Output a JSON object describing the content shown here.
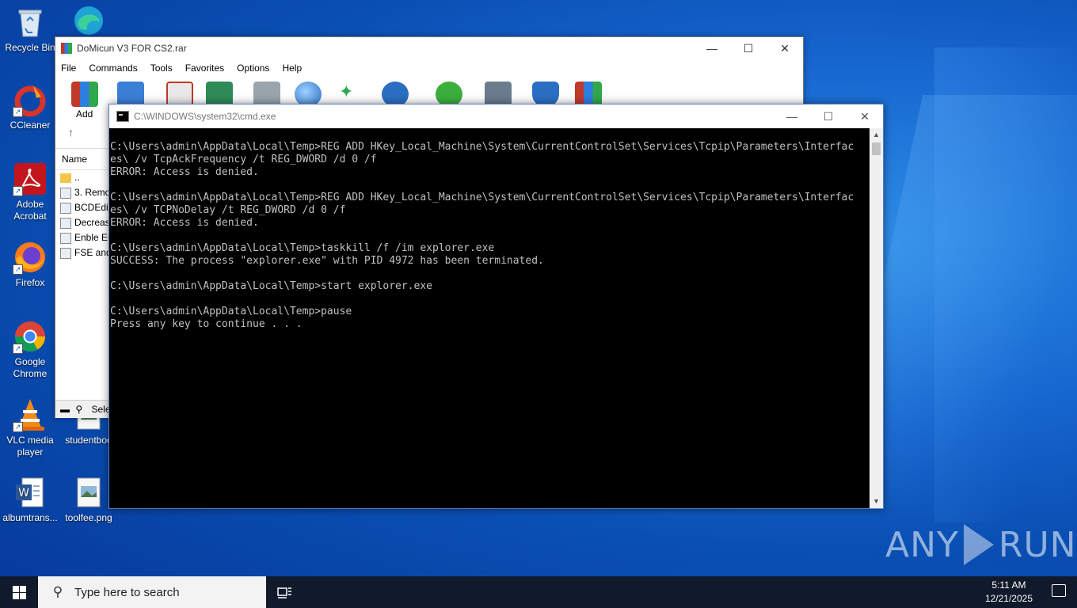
{
  "desktop": {
    "icons": [
      {
        "label": "Recycle Bin",
        "icon": "recycle-bin-icon"
      },
      {
        "label": "CCleaner",
        "icon": "ccleaner-icon"
      },
      {
        "label": "Adobe Acrobat",
        "icon": "adobe-acrobat-icon"
      },
      {
        "label": "Firefox",
        "icon": "firefox-icon"
      },
      {
        "label": "Google Chrome",
        "icon": "chrome-icon"
      },
      {
        "label": "VLC media player",
        "icon": "vlc-icon"
      },
      {
        "label": "albumtrans...",
        "icon": "word-doc-icon"
      },
      {
        "label": "studentboo",
        "icon": "image-file-icon"
      },
      {
        "label": "toolfee.png",
        "icon": "image-file-icon"
      }
    ]
  },
  "winrar": {
    "title": "DoMicun V3 FOR CS2.rar",
    "menu": [
      "File",
      "Commands",
      "Tools",
      "Favorites",
      "Options",
      "Help"
    ],
    "toolbar_add_label": "Add",
    "list_header": "Name",
    "files": [
      "..",
      "3. Remo",
      "BCDEdit",
      "Decrease",
      "Enble EC",
      "FSE and"
    ],
    "status_text": "Sele"
  },
  "cmd": {
    "title": "C:\\WINDOWS\\system32\\cmd.exe",
    "lines": [
      "C:\\Users\\admin\\AppData\\Local\\Temp>REG ADD HKey_Local_Machine\\System\\CurrentControlSet\\Services\\Tcpip\\Parameters\\Interfac",
      "es\\ /v TcpAckFrequency /t REG_DWORD /d 0 /f",
      "ERROR: Access is denied.",
      "",
      "C:\\Users\\admin\\AppData\\Local\\Temp>REG ADD HKey_Local_Machine\\System\\CurrentControlSet\\Services\\Tcpip\\Parameters\\Interfac",
      "es\\ /v TCPNoDelay /t REG_DWORD /d 0 /f",
      "ERROR: Access is denied.",
      "",
      "C:\\Users\\admin\\AppData\\Local\\Temp>taskkill /f /im explorer.exe",
      "SUCCESS: The process \"explorer.exe\" with PID 4972 has been terminated.",
      "",
      "C:\\Users\\admin\\AppData\\Local\\Temp>start explorer.exe",
      "",
      "C:\\Users\\admin\\AppData\\Local\\Temp>pause",
      "Press any key to continue . . ."
    ]
  },
  "watermark": {
    "left": "ANY",
    "right": "RUN"
  },
  "taskbar": {
    "search_placeholder": "Type here to search",
    "time": "5:11 AM",
    "date": "12/21/2025"
  }
}
